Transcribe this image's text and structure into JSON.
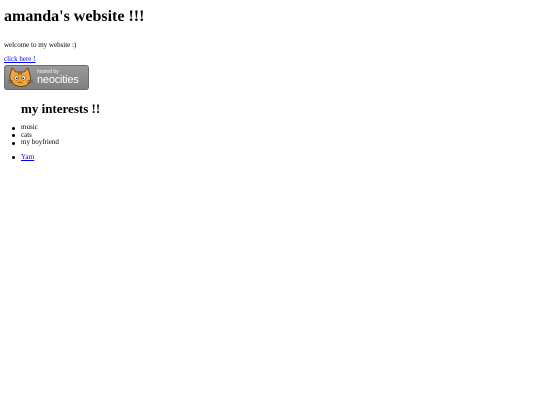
{
  "site": {
    "title": "amanda's website !!!",
    "welcome": "welcome to my website :)",
    "click_link": "click here !"
  },
  "badge": {
    "small_text": "hosted by",
    "big_text": "neocities",
    "icon": "neocities-cat-icon"
  },
  "interests": {
    "title": "my interests !!",
    "items": [
      "music",
      "cats",
      "my boyfriend"
    ],
    "links": [
      "Yarn"
    ]
  },
  "colors": {
    "link": "#0000ee",
    "badge_bg": "#8a8a8a",
    "cat_orange": "#f2a53a"
  }
}
